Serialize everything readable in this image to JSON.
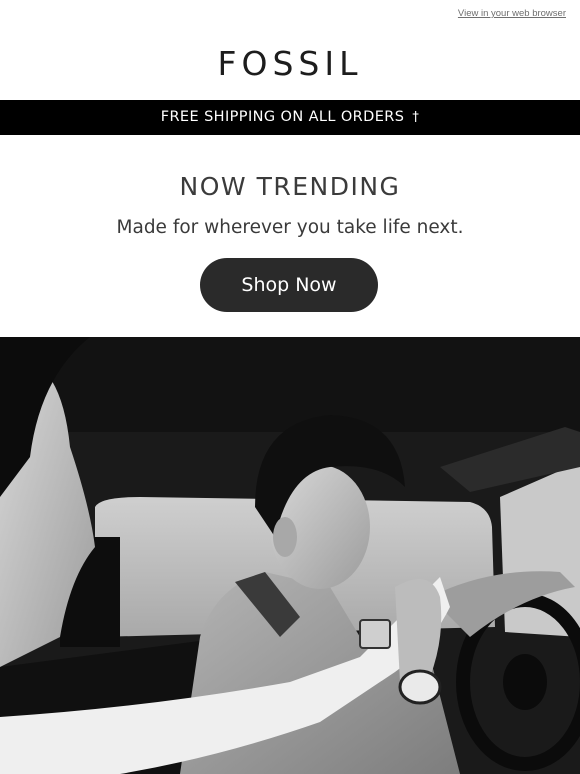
{
  "header": {
    "view_in_browser": "View in your web browser",
    "brand": "FOSSIL"
  },
  "promo": {
    "text": "FREE SHIPPING ON ALL ORDERS",
    "symbol": "†"
  },
  "main": {
    "headline": "NOW TRENDING",
    "subhead": "Made for wherever you take life next.",
    "cta_label": "Shop Now"
  },
  "hero": {
    "alt_description": "Black and white photo of a young man in a car kissing the hand of a woman, wearing a chronograph watch"
  }
}
